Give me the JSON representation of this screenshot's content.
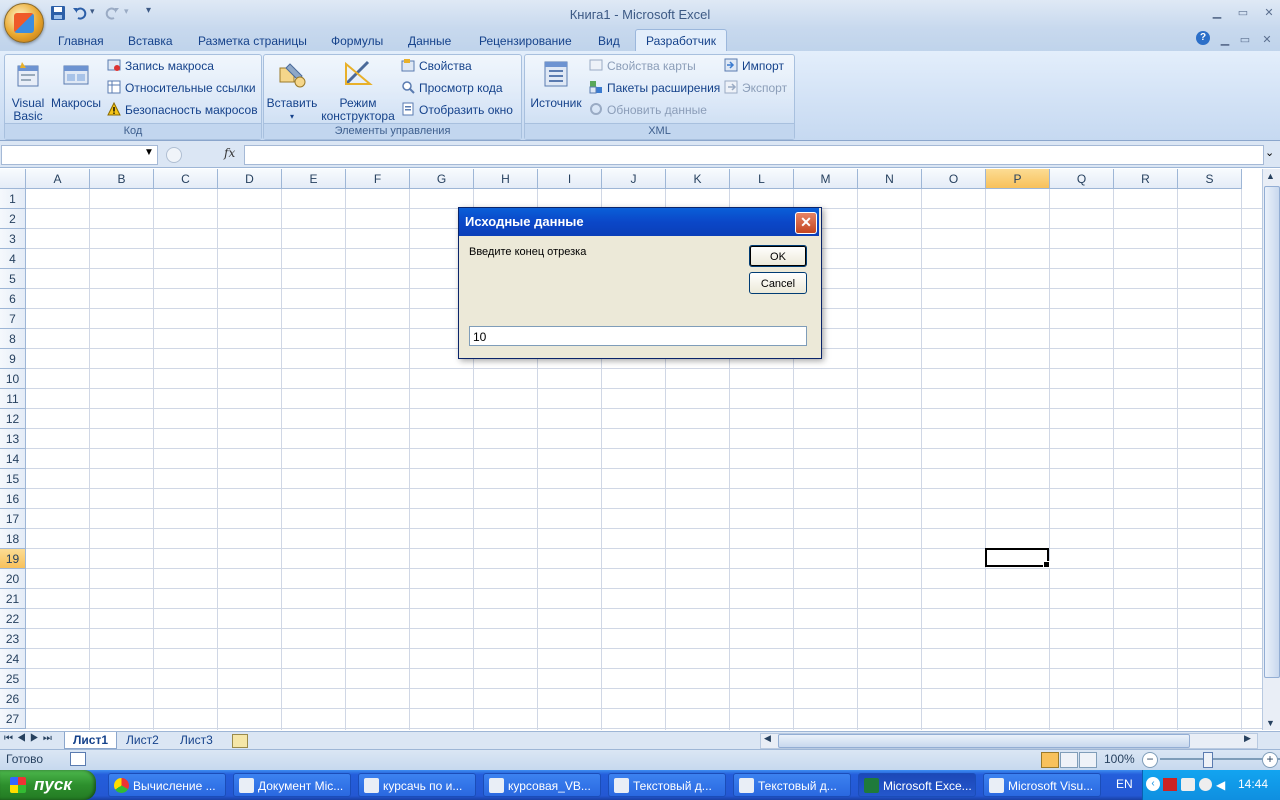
{
  "window": {
    "title": "Книга1 - Microsoft Excel"
  },
  "tabs": [
    "Главная",
    "Вставка",
    "Разметка страницы",
    "Формулы",
    "Данные",
    "Рецензирование",
    "Вид",
    "Разработчик"
  ],
  "ribbon": {
    "code": {
      "label": "Код",
      "visual_basic_1": "Visual",
      "visual_basic_2": "Basic",
      "macros": "Макросы",
      "record_macro": "Запись макроса",
      "relative_refs": "Относительные ссылки",
      "macro_security": "Безопасность макросов"
    },
    "controls": {
      "label": "Элементы управления",
      "insert": "Вставить",
      "design_mode_1": "Режим",
      "design_mode_2": "конструктора",
      "properties": "Свойства",
      "view_code": "Просмотр кода",
      "run_dialog": "Отобразить окно"
    },
    "xml": {
      "label": "XML",
      "source": "Источник",
      "map_properties": "Свойства карты",
      "expansion_packs": "Пакеты расширения",
      "refresh_data": "Обновить данные",
      "import": "Импорт",
      "export": "Экспорт"
    }
  },
  "formula_bar": {
    "name_box": "",
    "fx": "fx",
    "formula": ""
  },
  "grid": {
    "columns": [
      "A",
      "B",
      "C",
      "D",
      "E",
      "F",
      "G",
      "H",
      "I",
      "J",
      "K",
      "L",
      "M",
      "N",
      "O",
      "P",
      "Q",
      "R",
      "S"
    ],
    "rows": [
      "1",
      "2",
      "3",
      "4",
      "5",
      "6",
      "7",
      "8",
      "9",
      "10",
      "11",
      "12",
      "13",
      "14",
      "15",
      "16",
      "17",
      "18",
      "19",
      "20",
      "21",
      "22",
      "23",
      "24",
      "25",
      "26",
      "27"
    ],
    "selected_column": "P",
    "selected_row": "19"
  },
  "sheets": [
    "Лист1",
    "Лист2",
    "Лист3"
  ],
  "status": {
    "ready": "Готово",
    "zoom": "100%"
  },
  "dialog": {
    "title": "Исходные данные",
    "prompt": "Введите конец отрезка",
    "ok": "OK",
    "cancel": "Cancel",
    "value": "10"
  },
  "taskbar": {
    "start": "пуск",
    "tasks": [
      "Вычисление ...",
      "Документ Mic...",
      "курсачь по и...",
      "курсовая_VB...",
      "Текстовый д...",
      "Текстовый д...",
      "Microsoft Exce...",
      "Microsoft Visu..."
    ],
    "lang": "EN",
    "clock": "14:44"
  }
}
